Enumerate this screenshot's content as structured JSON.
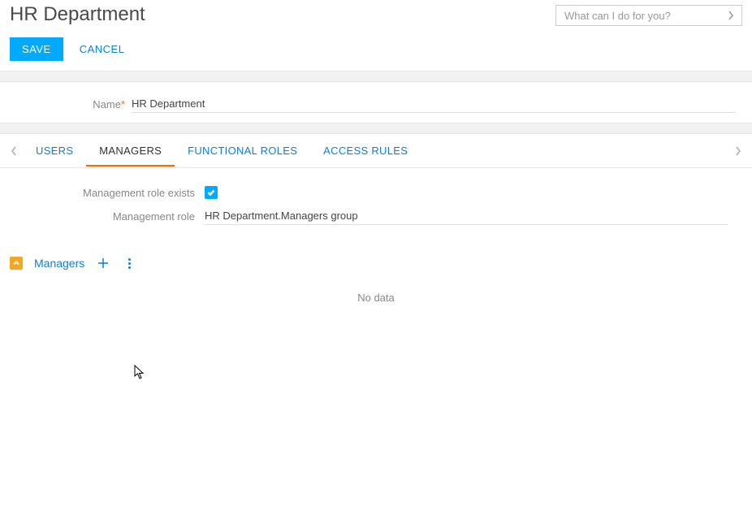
{
  "header": {
    "title": "HR Department",
    "search_placeholder": "What can I do for you?"
  },
  "actions": {
    "save": "SAVE",
    "cancel": "CANCEL"
  },
  "fields": {
    "name_label": "Name",
    "name_value": "HR Department"
  },
  "tabs": {
    "users": "USERS",
    "managers": "MANAGERS",
    "functional_roles": "FUNCTIONAL ROLES",
    "access_rules": "ACCESS RULES"
  },
  "managers_tab": {
    "role_exists_label": "Management role exists",
    "role_exists_checked": true,
    "role_label": "Management role",
    "role_value": "HR Department.Managers group"
  },
  "detail": {
    "title": "Managers",
    "empty_text": "No data"
  }
}
